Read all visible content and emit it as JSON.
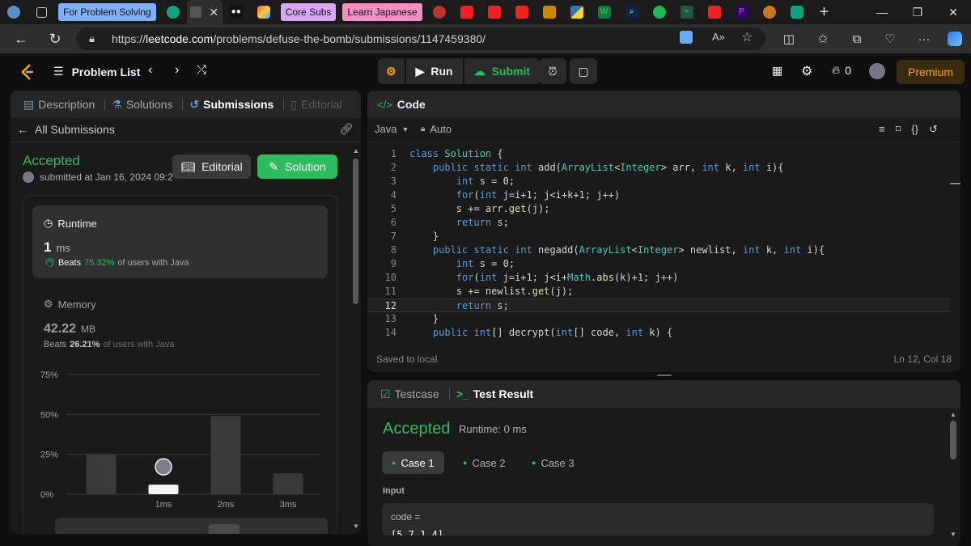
{
  "browser": {
    "tab_labels": [
      {
        "text": "For Problem Solving",
        "bg": "#7fb0f5"
      },
      {
        "text": "Core Subs",
        "bg": "#d7a6f5"
      },
      {
        "text": "Learn Japanese",
        "bg": "#f48fc6"
      }
    ],
    "url_prefix": "https://",
    "url_host": "leetcode.com",
    "url_path": "/problems/defuse-the-bomb/submissions/1147459380/"
  },
  "nav": {
    "problem_list": "Problem List",
    "run": "Run",
    "submit": "Submit",
    "fire_count": "0",
    "premium": "Premium"
  },
  "left_panel": {
    "tabs": {
      "description": "Description",
      "solutions": "Solutions",
      "submissions": "Submissions",
      "editorial": "Editorial"
    },
    "back_label": "All Submissions",
    "status": "Accepted",
    "submitted_at": "submitted at Jan 16, 2024 09:2",
    "editorial_button": "Editorial",
    "solution_button": "Solution",
    "runtime": {
      "title": "Runtime",
      "value": "1",
      "unit": "ms",
      "beats_label": "Beats",
      "beats_pct": "75.32%",
      "beats_suffix": "of users with Java"
    },
    "memory": {
      "title": "Memory",
      "value": "42.22",
      "unit": "MB",
      "beats_label": "Beats",
      "beats_pct": "26.21%",
      "beats_suffix": "of users with Java"
    }
  },
  "chart_data": {
    "type": "bar",
    "categories": [
      "",
      "1ms",
      "2ms",
      "3ms"
    ],
    "values": [
      25,
      6,
      49,
      13
    ],
    "highlight_index": 1,
    "yticks": [
      "75%",
      "50%",
      "25%",
      "0%"
    ],
    "ylim": [
      0,
      75
    ],
    "grid": true
  },
  "editor": {
    "title": "Code",
    "language": "Java",
    "mode": "Auto",
    "lines": [
      "class Solution {",
      "    public static int add(ArrayList<Integer> arr, int k, int i){",
      "        int s = 0;",
      "        for(int j=i+1; j<i+k+1; j++)",
      "        s += arr.get(j);",
      "        return s;",
      "    }",
      "    public static int negadd(ArrayList<Integer> newlist, int k, int i){",
      "        int s = 0;",
      "        for(int j=i+1; j<i+Math.abs(k)+1; j++)",
      "        s += newlist.get(j);",
      "        return s;",
      "    }",
      "    public int[] decrypt(int[] code, int k) {"
    ],
    "current_line": 12,
    "saved_text": "Saved to local",
    "cursor_pos": "Ln 12, Col 18"
  },
  "bottom_panel": {
    "testcase_tab": "Testcase",
    "result_tab": "Test Result",
    "status": "Accepted",
    "runtime": "Runtime: 0 ms",
    "cases": [
      "Case 1",
      "Case 2",
      "Case 3"
    ],
    "input_label": "Input",
    "input_var": "code =",
    "input_value": "[5,7,1,4]"
  }
}
